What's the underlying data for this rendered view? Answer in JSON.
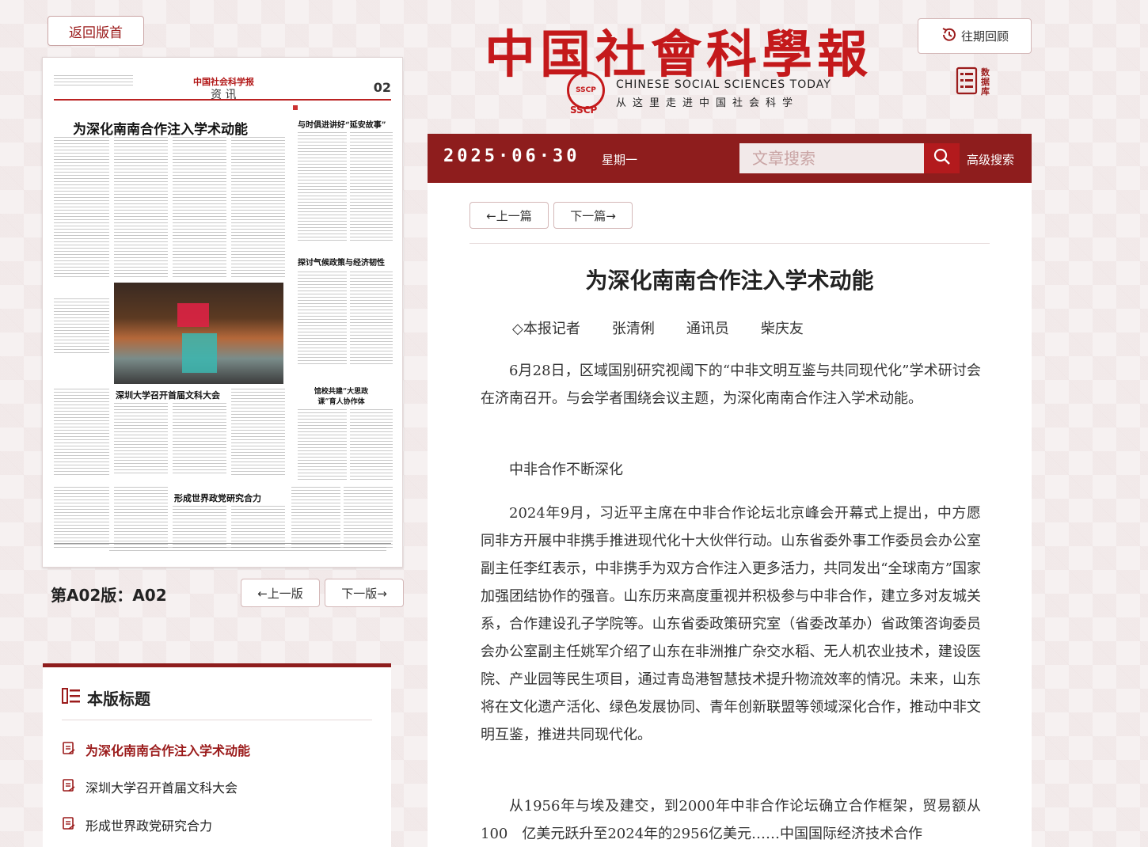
{
  "left": {
    "back_button": "返回版首",
    "edition_label": "第A02版：A02",
    "prev_edition": "←上一版",
    "next_edition": "下一版→",
    "newspaper": {
      "masthead": "中国社会科学报",
      "section": "资 讯",
      "page_number": "02",
      "headlines": [
        "为深化南南合作注入学术动能",
        "与时俱进讲好“延安故事”",
        "探讨气候政策与经济韧性",
        "深圳大学召开首届文科大会",
        "馆校共建“大思政课”育人协作体",
        "形成世界政党研究合力"
      ]
    },
    "contents": {
      "heading": "本版标题",
      "items": [
        "为深化南南合作注入学术动能",
        "深圳大学召开首届文科大会",
        "形成世界政党研究合力"
      ]
    }
  },
  "header": {
    "title": "中国社會科學報",
    "seal": "SSCP",
    "seal_text": "SSCP",
    "english": "CHINESE SOCIAL SCIENCES TODAY",
    "slogan": "从这里走进中国社会科学",
    "history_button": "往期回顾",
    "database_label": "数据库"
  },
  "bar": {
    "date": "2025·06·30",
    "weekday": "星期一",
    "search_placeholder": "文章搜索",
    "advanced_search": "高级搜索"
  },
  "article": {
    "prev_button": "←上一篇",
    "next_button": "下一篇→",
    "title": "为深化南南合作注入学术动能",
    "byline": [
      "◇本报记者",
      "张清俐",
      "通讯员",
      "柴庆友"
    ],
    "paragraphs": [
      "6月28日，区域国别研究视阈下的“中非文明互鉴与共同现代化”学术研讨会在济南召开。与会学者围绕会议主题，为深化南南合作注入学术动能。",
      "中非合作不断深化",
      "2024年9月，习近平主席在中非合作论坛北京峰会开幕式上提出，中方愿同非方开展中非携手推进现代化十大伙伴行动。山东省委外事工作委员会办公室副主任李红表示，中非携手为双方合作注入更多活力，共同发出“全球南方”国家加强团结协作的强音。山东历来高度重视并积极参与中非合作，建立多对友城关系，合作建设孔子学院等。山东省委政策研究室（省委改革办）省政策咨询委员会办公室副主任姚军介绍了山东在非洲推广杂交水稻、无人机农业技术，建设医院、产业园等民生项目，通过青岛港智慧技术提升物流效率的情况。未来，山东将在文化遗产活化、绿色发展协同、青年创新联盟等领域深化合作，推动中非文明互鉴，推进共同现代化。",
      "从1956年与埃及建交，到2000年中非合作论坛确立合作框架，贸易额从100　亿美元跃升至2024年的2956亿美元……中国国际经济技术合作"
    ]
  },
  "colors": {
    "brand_red": "#c4191b",
    "bar_red": "#8e1d1d",
    "accent": "#9b1b1b"
  }
}
